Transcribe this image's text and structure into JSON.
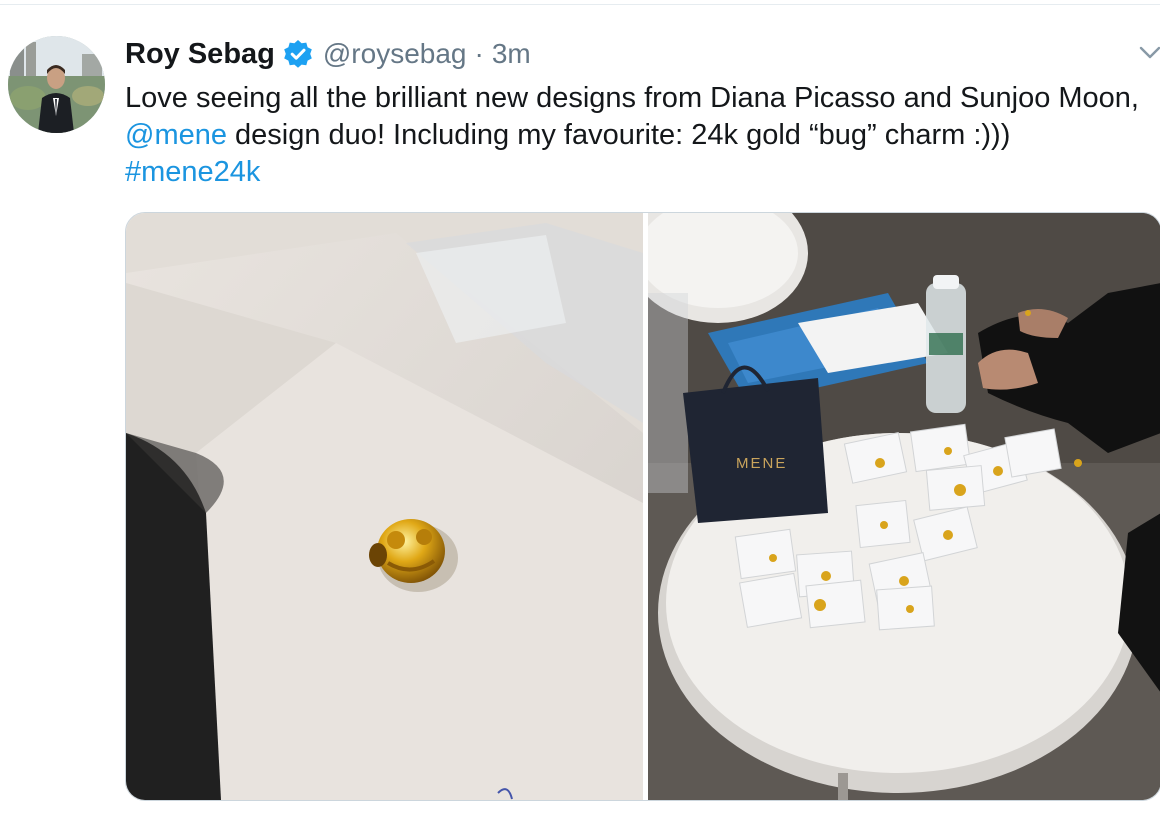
{
  "tweet": {
    "author_name": "Roy Sebag",
    "handle": "@roysebag",
    "separator": "·",
    "time": "3m",
    "text_parts": {
      "p1": "Love seeing all the brilliant new designs from Diana Picasso and Sunjoo Moon, ",
      "mention": "@mene",
      "p2": " design duo! Including my favourite: 24k gold “bug” charm :))) ",
      "hashtag": "#mene24k"
    },
    "bag_logo_text": "MENE"
  },
  "colors": {
    "link": "#1b95e0",
    "verified_badge": "#1da1f2",
    "secondary_text": "#657786",
    "primary_text": "#14171a"
  },
  "icons": {
    "verified": "verified-badge-icon",
    "caret": "chevron-down-icon"
  }
}
